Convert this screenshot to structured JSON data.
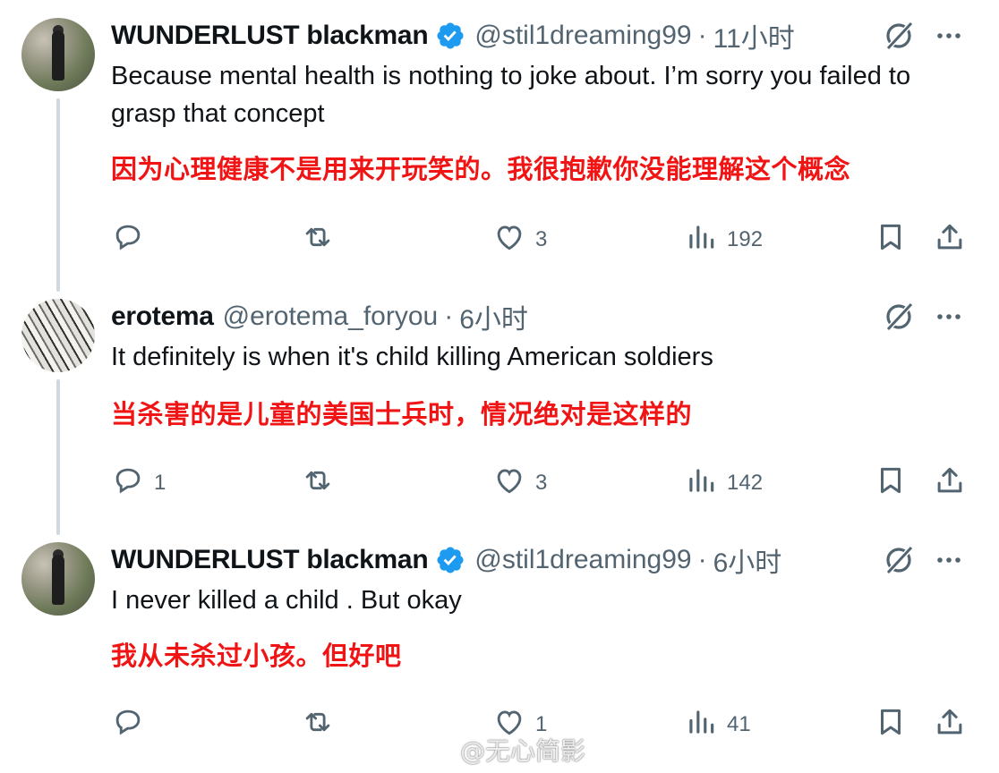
{
  "colors": {
    "text": "#0f1419",
    "secondary": "#536471",
    "verified": "#1d9bf0",
    "translation": "#f01414",
    "thread": "#cfd9de"
  },
  "tweets": [
    {
      "name": "WUNDERLUST blackman",
      "verified": true,
      "handle": "@stil1dreaming99",
      "separator": "·",
      "time": "11小时",
      "text": "Because mental health is nothing to joke about. I’m sorry you failed to grasp that concept",
      "translation": "因为心理健康不是用来开玩笑的。我很抱歉你没能理解这个概念",
      "replies": "",
      "retweets": "",
      "likes": "3",
      "views": "192",
      "avatar": "street-photo"
    },
    {
      "name": "erotema",
      "verified": false,
      "handle": "@erotema_foryou",
      "separator": "·",
      "time": "6小时",
      "text": "It definitely is when it's child killing American soldiers",
      "translation": "当杀害的是儿童的美国士兵时，情况绝对是这样的",
      "replies": "1",
      "retweets": "",
      "likes": "3",
      "views": "142",
      "avatar": "artwork"
    },
    {
      "name": "WUNDERLUST blackman",
      "verified": true,
      "handle": "@stil1dreaming99",
      "separator": "·",
      "time": "6小时",
      "text": "I never killed a child . But okay",
      "translation": "我从未杀过小孩。但好吧",
      "replies": "",
      "retweets": "",
      "likes": "1",
      "views": "41",
      "avatar": "street-photo"
    }
  ],
  "icons": [
    "verified-badge-icon",
    "grok-icon",
    "more-icon",
    "reply-icon",
    "retweet-icon",
    "like-icon",
    "views-icon",
    "bookmark-icon",
    "share-icon",
    "weibo-logo-icon"
  ],
  "watermark": {
    "text": "@无心简影"
  }
}
